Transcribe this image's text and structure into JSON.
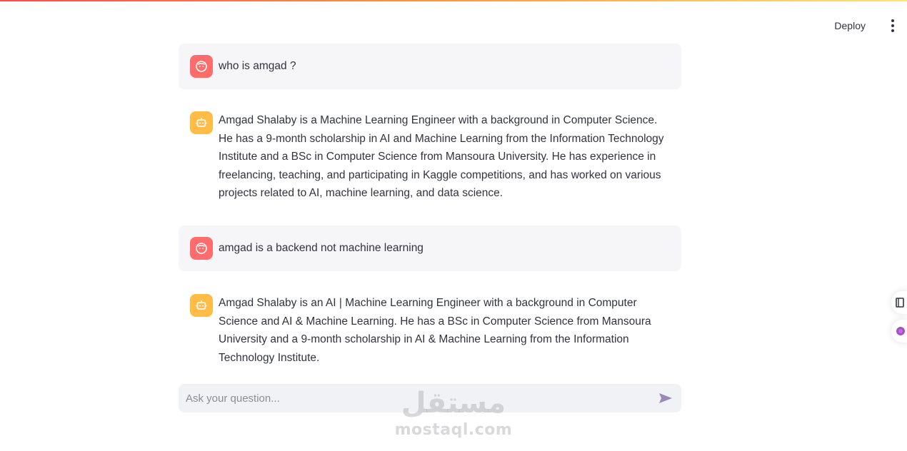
{
  "header": {
    "deploy_label": "Deploy",
    "menu_icon": "kebab-menu-icon"
  },
  "messages": [
    {
      "role": "user",
      "avatar_icon": "user-face-icon",
      "text": "who is amgad ?"
    },
    {
      "role": "assistant",
      "avatar_icon": "robot-icon",
      "text": "Amgad Shalaby is a Machine Learning Engineer with a background in Computer Science. He has a 9-month scholarship in AI and Machine Learning from the Information Technology Institute and a BSc in Computer Science from Mansoura University. He has experience in freelancing, teaching, and participating in Kaggle competitions, and has worked on various projects related to AI, machine learning, and data science."
    },
    {
      "role": "user",
      "avatar_icon": "user-face-icon",
      "text": "amgad is a backend not machine learning"
    },
    {
      "role": "assistant",
      "avatar_icon": "robot-icon",
      "text": "Amgad Shalaby is an AI | Machine Learning Engineer with a background in Computer Science and AI & Machine Learning. He has a BSc in Computer Science from Mansoura University and a 9-month scholarship in AI & Machine Learning from the Information Technology Institute."
    }
  ],
  "chat_input": {
    "placeholder": "Ask your question...",
    "value": "",
    "send_icon": "send-arrow-icon"
  },
  "watermark": {
    "arabic": "مستقل",
    "latin": "mostaql.com"
  },
  "colors": {
    "user_avatar": "#ff6c6c",
    "bot_avatar": "#ffbd45",
    "user_bubble": "#f6f6f8",
    "input_bg": "#f0f2f6",
    "send_icon": "#9c89b8"
  }
}
